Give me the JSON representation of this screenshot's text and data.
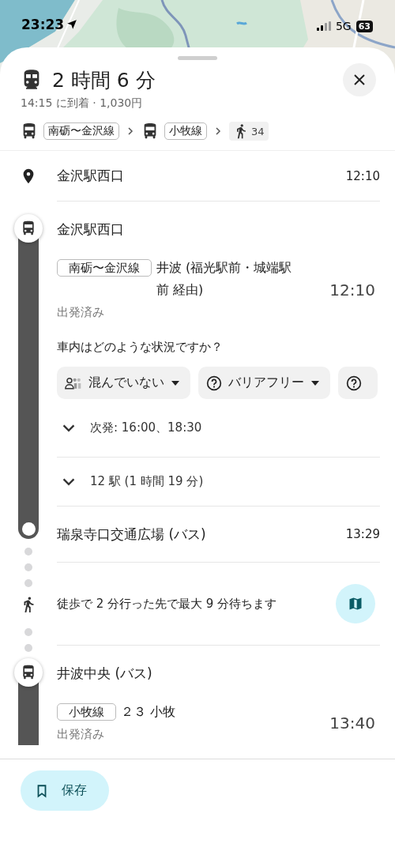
{
  "status_bar": {
    "time": "23:23",
    "network": "5G",
    "battery": "63"
  },
  "header": {
    "title": "2 時間 6 分",
    "subtitle": "14:15 に到着 · 1,030円",
    "steps": [
      {
        "kind": "bus",
        "label": "南砺〜金沢線"
      },
      {
        "kind": "bus",
        "label": "小牧線"
      },
      {
        "kind": "walk",
        "label": "34"
      }
    ]
  },
  "timeline": [
    {
      "kind": "place",
      "name": "金沢駅西口",
      "time": "12:10"
    },
    {
      "kind": "transit",
      "stop": "金沢駅西口",
      "line": "南砺〜金沢線",
      "headsign": "井波 (福光駅前・城端駅前 経由)",
      "status": "出発済み",
      "time": "12:10",
      "question": "車内はどのような状況ですか？",
      "chips": [
        {
          "kind": "crowd",
          "label": "混んでいない"
        },
        {
          "kind": "help",
          "label": "バリアフリー"
        },
        {
          "kind": "help"
        }
      ],
      "expanders": [
        {
          "label": "次発: 16:00、18:30",
          "expanded": false
        },
        {
          "label": "12 駅 (1 時間 19 分)",
          "expanded": false
        }
      ],
      "arrival": {
        "name": "瑞泉寺口交通広場 (バス)",
        "time": "13:29"
      }
    },
    {
      "kind": "walk",
      "text": "徒歩で 2 分行った先で最大 9 分待ちます"
    },
    {
      "kind": "transit",
      "stop": "井波中央 (バス)",
      "line": "小牧線",
      "headsign": "２３ 小牧",
      "status": "出発済み",
      "time": "13:40"
    }
  ],
  "footer": {
    "save": "保存"
  }
}
